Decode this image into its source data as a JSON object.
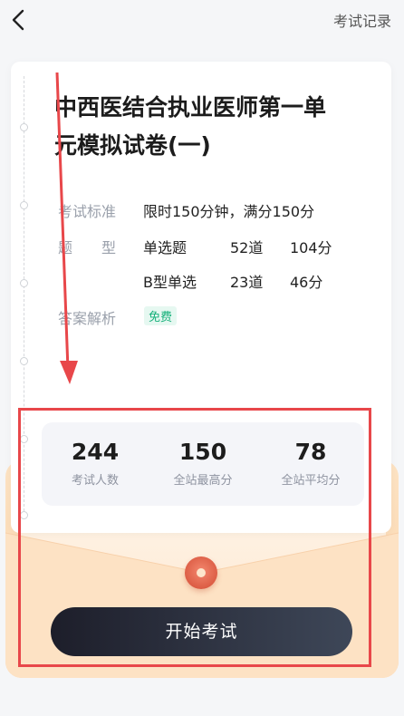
{
  "header": {
    "record_link": "考试记录"
  },
  "exam": {
    "title_line1": "中西医结合执业医师第一单",
    "title_line2": "元模拟试卷(一)",
    "standard_label": "考试标准",
    "standard_value": "限时150分钟，满分150分",
    "type_label": "题　　型",
    "types": [
      {
        "name": "单选题",
        "count": "52道",
        "score": "104分"
      },
      {
        "name": "B型单选",
        "count": "23道",
        "score": "46分"
      }
    ],
    "analysis_label": "答案解析",
    "analysis_badge": "免费"
  },
  "stats": [
    {
      "value": "244",
      "label": "考试人数"
    },
    {
      "value": "150",
      "label": "全站最高分"
    },
    {
      "value": "78",
      "label": "全站平均分"
    }
  ],
  "start_button": "开始考试",
  "colors": {
    "highlight_box": "#e8474a",
    "free_badge": "#16b07a",
    "button_dark": "#1d1e2a"
  }
}
